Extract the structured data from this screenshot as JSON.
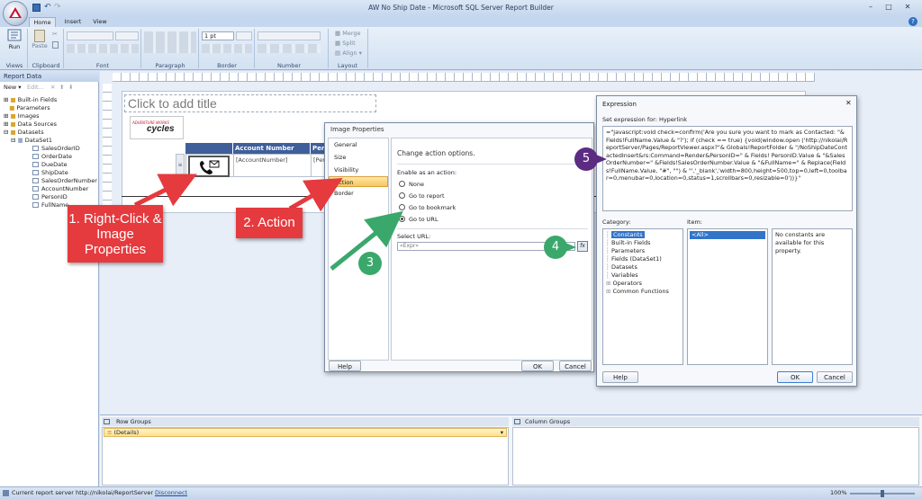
{
  "app": {
    "title": "AW No Ship Date - Microsoft SQL Server Report Builder",
    "tabs": [
      "Home",
      "Insert",
      "View"
    ],
    "ribbon": {
      "run_label": "Run",
      "paste_label": "Paste",
      "line_width": "1 pt",
      "merge_label": "Merge",
      "split_label": "Split",
      "align_label": "Align",
      "groups": [
        "Views",
        "Clipboard",
        "Font",
        "Paragraph",
        "Border",
        "Number",
        "Layout"
      ]
    }
  },
  "report_data": {
    "title": "Report Data",
    "new_label": "New",
    "edit_label": "Edit...",
    "tree": [
      "Built-in Fields",
      "Parameters",
      "Images",
      "Data Sources",
      "Datasets",
      "DataSet1"
    ],
    "fields": [
      "SalesOrderID",
      "OrderDate",
      "DueDate",
      "ShipDate",
      "SalesOrderNumber",
      "AccountNumber",
      "PersonID",
      "FullName"
    ]
  },
  "canvas": {
    "title_placeholder": "Click to add title",
    "logo_top": "ADVENTURE WORKS",
    "logo_bottom": "cycles",
    "col_account": "Account Number",
    "col_person": "Pers",
    "cell_account": "[AccountNumber]",
    "cell_person": "[Pers"
  },
  "image_props": {
    "title": "Image Properties",
    "nav": [
      "General",
      "Size",
      "Visibility",
      "Action",
      "Border"
    ],
    "heading": "Change action options.",
    "enable_label": "Enable as an action:",
    "options": [
      "None",
      "Go to report",
      "Go to bookmark",
      "Go to URL"
    ],
    "select_url_label": "Select URL:",
    "url_value": "«Expr»",
    "fx_label": "fx",
    "help": "Help",
    "ok": "OK",
    "cancel": "Cancel"
  },
  "expression": {
    "title": "Expression",
    "set_label": "Set expression for: Hyperlink",
    "text": "=\"javascript:void check=confirm('Are you sure you want to mark as Contacted: \"& Fields!FullName.Value & \"?'); if (check == true) {void(window.open ('http://nikolai/ReportServer/Pages/ReportViewer.aspx?\"& Globals!ReportFolder & \"/NoShipDateContactedInsert&rs:Command=Render&PersonID=\" & Fields! PersonID.Value & \"&SalesOrderNumber=\" &Fields!SalesOrderNumber.Value & \"&FullName=\" & Replace(Fields!FullName.Value, \"#\", \"\") & \"','_blank','width=800,height=500,top=0,left=0,toolbar=0,menubar=0,location=0,status=1,scrollbars=0,resizable=0'))}\"",
    "category_label": "Category:",
    "item_label": "Item:",
    "categories": [
      "Constants",
      "Built-in Fields",
      "Parameters",
      "Fields (DataSet1)",
      "Datasets",
      "Variables",
      "Operators",
      "Common Functions"
    ],
    "item": "<All>",
    "note": "No constants are available for this property.",
    "help": "Help",
    "ok": "OK",
    "cancel": "Cancel"
  },
  "groups": {
    "row": "Row Groups",
    "column": "Column Groups",
    "details": "(Details)"
  },
  "status": {
    "text": "Current report server http://nikolai/ReportServer",
    "disconnect": "Disconnect",
    "zoom": "100%"
  },
  "callouts": {
    "c1": "1. Right-Click & Image Properties",
    "c2": "2. Action",
    "n3": "3",
    "n4": "4",
    "n5": "5"
  },
  "colors": {
    "red": "#e53a3e",
    "green": "#3aa86b",
    "purple": "#5b2c82",
    "ribbon": "#dfe9f5",
    "header_blue": "#3f5f9a"
  }
}
